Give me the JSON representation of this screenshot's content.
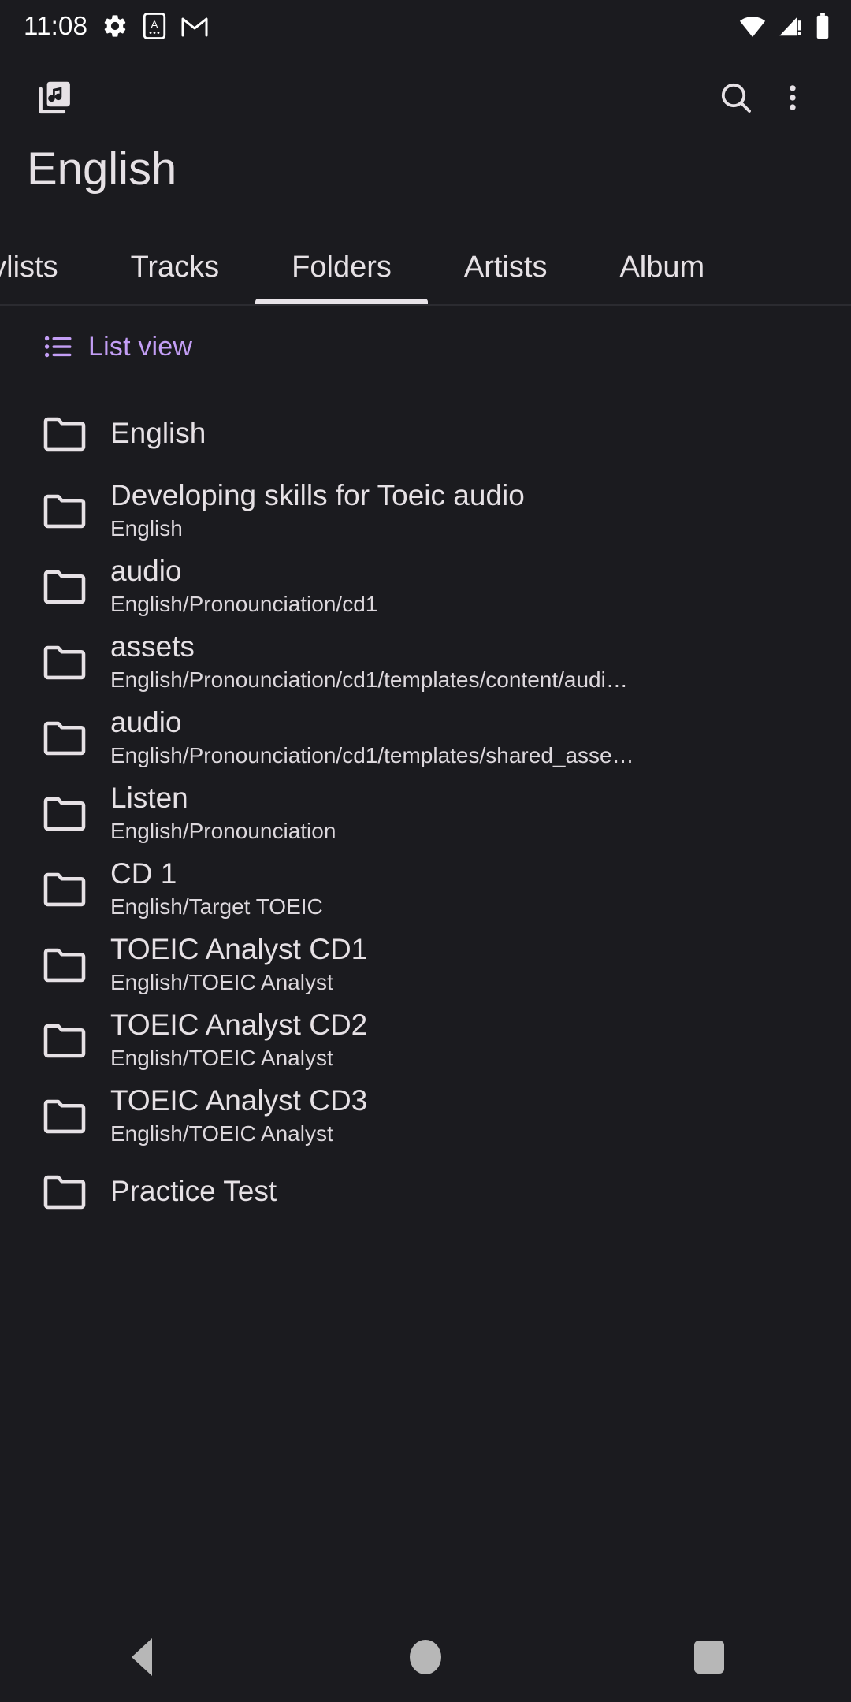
{
  "status_bar": {
    "time": "11:08",
    "left_icons": [
      "gear-icon",
      "app-a-icon",
      "gmail-icon"
    ],
    "right_icons": [
      "wifi-icon",
      "cellular-signal-icon",
      "battery-icon"
    ]
  },
  "app_bar": {
    "library_icon": "music-library-icon",
    "search_icon": "search-icon",
    "overflow_icon": "overflow-menu-icon"
  },
  "header": {
    "title": "English"
  },
  "tabs": {
    "items": [
      {
        "label": "aylists",
        "active": false
      },
      {
        "label": "Tracks",
        "active": false
      },
      {
        "label": "Folders",
        "active": true
      },
      {
        "label": "Artists",
        "active": false
      },
      {
        "label": "Album",
        "active": false
      }
    ]
  },
  "view_mode": {
    "label": "List view",
    "icon": "list-view-icon",
    "accent_color": "#c39ef5"
  },
  "folders": [
    {
      "name": "English",
      "path": ""
    },
    {
      "name": "Developing skills for Toeic audio",
      "path": "English"
    },
    {
      "name": "audio",
      "path": "English/Pronounciation/cd1"
    },
    {
      "name": "assets",
      "path": "English/Pronounciation/cd1/templates/content/audi…"
    },
    {
      "name": "audio",
      "path": "English/Pronounciation/cd1/templates/shared_asse…"
    },
    {
      "name": "Listen",
      "path": "English/Pronounciation"
    },
    {
      "name": "CD 1",
      "path": "English/Target TOEIC"
    },
    {
      "name": "TOEIC Analyst CD1",
      "path": "English/TOEIC Analyst"
    },
    {
      "name": "TOEIC Analyst CD2",
      "path": "English/TOEIC Analyst"
    },
    {
      "name": "TOEIC Analyst CD3",
      "path": "English/TOEIC Analyst"
    },
    {
      "name": "Practice Test",
      "path": ""
    }
  ],
  "nav_bar": {
    "back": "back-button",
    "home": "home-button",
    "recents": "recents-button"
  },
  "colors": {
    "background": "#1b1b1f",
    "text_primary": "#e6e1e5",
    "text_secondary": "#ddd8dd",
    "accent": "#c39ef5",
    "tab_indicator": "#e8e3e8"
  }
}
